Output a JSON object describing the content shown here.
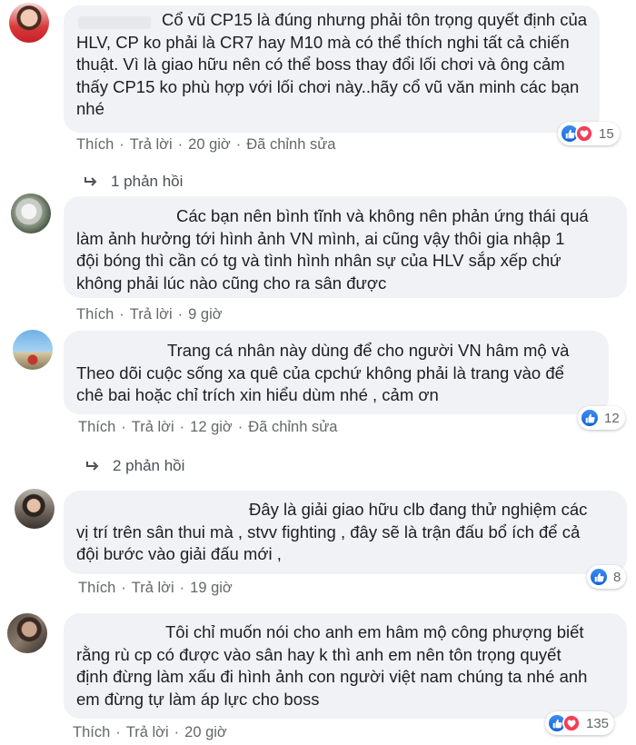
{
  "actions": {
    "like": "Thích",
    "reply": "Trả lời",
    "sep": "·"
  },
  "comments": [
    {
      "text": "Cổ vũ CP15 là đúng nhưng phải tôn trọng quyết định của\nHLV, CP ko phải là CR7 hay M10 mà có thể thích nghi tất cả chiến\nthuật. Vì là giao hữu nên có thể boss thay đổi lối chơi và ông cảm\nthấy CP15 ko phù hợp với lối chơi này..hãy cổ vũ văn minh các bạn\nnhé",
      "time": "20 giờ",
      "edited": "Đã chỉnh sửa",
      "reactions": "15",
      "replies": "1 phản hồi"
    },
    {
      "text": "Các bạn nên bình tĩnh và không nên phản ứng thái quá\nlàm ảnh hưởng tới hình ảnh VN mình, ai cũng vậy thôi gia nhập 1\nđội bóng thì cần có tg và tình hình nhân sự của HLV sắp xếp chứ\nkhông phải lúc nào cũng cho ra sân được",
      "time": "9 giờ"
    },
    {
      "text": "Trang cá nhân này dùng để cho người VN hâm mộ và\nTheo dõi cuộc sống xa quê của cpchứ không phải là trang vào để\nchê bai hoặc chỉ trích xin hiểu dùm nhé , cảm ơn",
      "time": "12 giờ",
      "edited": "Đã chỉnh sửa",
      "reactions": "12",
      "replies": "2 phản hồi"
    },
    {
      "text": "Đây là giải giao hữu clb đang thử nghiệm các\nvị trí trên sân thui mà , stvv fighting , đây sẽ là trận đấu bổ ích để cả\nđội bước vào giải đấu mới ,",
      "time": "19 giờ",
      "reactions": "8"
    },
    {
      "text": "Tôi chỉ muốn nói cho anh em hâm mộ công phượng biết\nrằng rù cp có được vào sân hay k thì anh em nên tôn trọng quyết\nđịnh đừng làm xấu đi hình ảnh con người việt nam chúng ta nhé anh\nem đừng tự làm áp lực cho boss",
      "time": "20 giờ",
      "reactions": "135"
    }
  ]
}
